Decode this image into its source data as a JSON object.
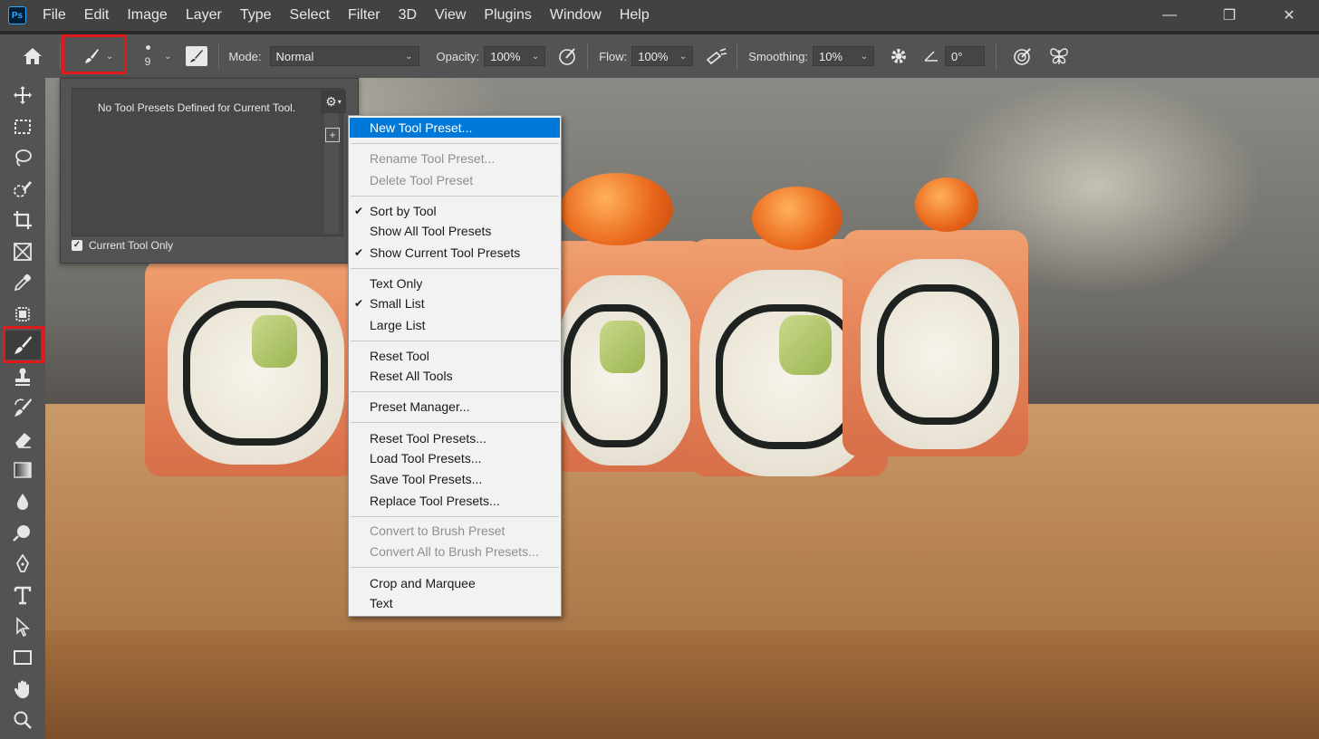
{
  "app": {
    "logo_text": "Ps",
    "menus": [
      "File",
      "Edit",
      "Image",
      "Layer",
      "Type",
      "Select",
      "Filter",
      "3D",
      "View",
      "Plugins",
      "Window",
      "Help"
    ]
  },
  "window_controls": {
    "minimize": "—",
    "restore": "❐",
    "close": "✕"
  },
  "options_bar": {
    "brush_size": "9",
    "mode_label": "Mode:",
    "mode_value": "Normal",
    "opacity_label": "Opacity:",
    "opacity_value": "100%",
    "flow_label": "Flow:",
    "flow_value": "100%",
    "smoothing_label": "Smoothing:",
    "smoothing_value": "10%",
    "angle_value": "0°"
  },
  "tools": [
    {
      "name": "move-tool",
      "icon": "move-icon"
    },
    {
      "name": "rectangular-marquee-tool",
      "icon": "marquee-icon"
    },
    {
      "name": "lasso-tool",
      "icon": "lasso-icon"
    },
    {
      "name": "quick-selection-tool",
      "icon": "quick-selection-icon"
    },
    {
      "name": "crop-tool",
      "icon": "crop-icon"
    },
    {
      "name": "frame-tool",
      "icon": "frame-icon"
    },
    {
      "name": "eyedropper-tool",
      "icon": "eyedropper-icon"
    },
    {
      "name": "spot-healing-tool",
      "icon": "healing-icon"
    },
    {
      "name": "brush-tool",
      "icon": "brush-icon",
      "selected": true
    },
    {
      "name": "clone-stamp-tool",
      "icon": "stamp-icon"
    },
    {
      "name": "history-brush-tool",
      "icon": "history-brush-icon"
    },
    {
      "name": "eraser-tool",
      "icon": "eraser-icon"
    },
    {
      "name": "gradient-tool",
      "icon": "gradient-icon"
    },
    {
      "name": "blur-tool",
      "icon": "drop-icon"
    },
    {
      "name": "dodge-tool",
      "icon": "dodge-icon"
    },
    {
      "name": "pen-tool",
      "icon": "pen-icon"
    },
    {
      "name": "type-tool",
      "icon": "type-icon"
    },
    {
      "name": "path-selection-tool",
      "icon": "arrow-icon"
    },
    {
      "name": "rectangle-tool",
      "icon": "rectangle-icon"
    },
    {
      "name": "hand-tool",
      "icon": "hand-icon"
    },
    {
      "name": "zoom-tool",
      "icon": "zoom-icon"
    }
  ],
  "preset_panel": {
    "empty_message": "No Tool Presets Defined for Current Tool.",
    "current_tool_only_label": "Current Tool Only",
    "current_tool_only_checked": true
  },
  "context_menu": {
    "items": [
      {
        "label": "New Tool Preset...",
        "highlighted": true
      },
      {
        "label": "Rename Tool Preset...",
        "disabled": true
      },
      {
        "label": "Delete Tool Preset",
        "disabled": true
      },
      {
        "label": "Sort by Tool",
        "checked": true
      },
      {
        "label": "Show All Tool Presets"
      },
      {
        "label": "Show Current Tool Presets",
        "checked": true
      },
      {
        "label": "Text Only"
      },
      {
        "label": "Small List",
        "checked": true
      },
      {
        "label": "Large List"
      },
      {
        "label": "Reset Tool"
      },
      {
        "label": "Reset All Tools"
      },
      {
        "label": "Preset Manager..."
      },
      {
        "label": "Reset Tool Presets..."
      },
      {
        "label": "Load Tool Presets..."
      },
      {
        "label": "Save Tool Presets..."
      },
      {
        "label": "Replace Tool Presets..."
      },
      {
        "label": "Convert to Brush Preset",
        "disabled": true
      },
      {
        "label": "Convert All to Brush Presets...",
        "disabled": true
      },
      {
        "label": "Crop and Marquee"
      },
      {
        "label": "Text"
      }
    ],
    "check_glyph": "✔"
  },
  "colors": {
    "highlight": "#0078d7",
    "annotation_red": "#e01b1b"
  }
}
